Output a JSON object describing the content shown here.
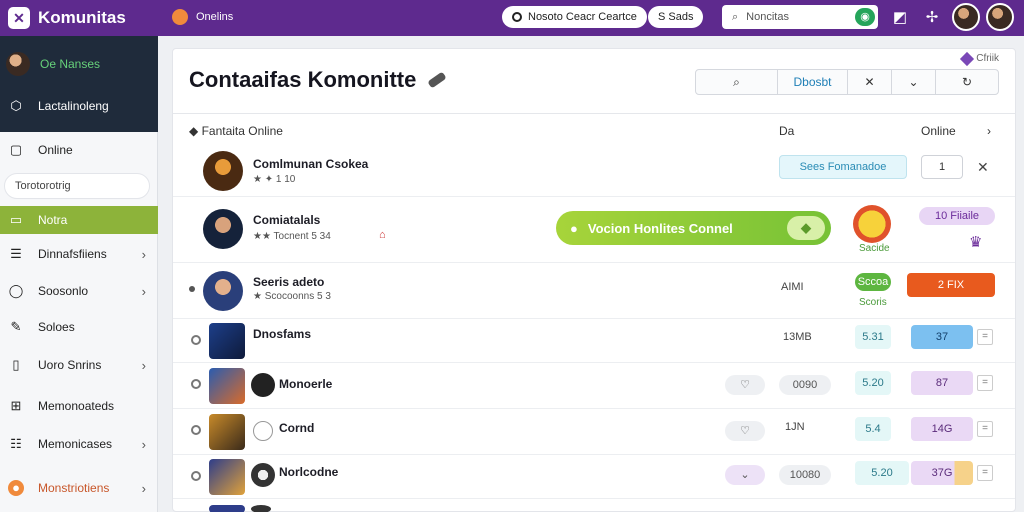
{
  "topbar": {
    "brand": "Komunitas",
    "status": "Onelins",
    "pill_left": "Nosoto Ceacr Ceartce",
    "pill_right": "S Sads",
    "search_placeholder": "Noncitas"
  },
  "sidebar": {
    "user": "Oe Nanses",
    "items": [
      {
        "label": "Lactalinoleng",
        "icon": "cube-icon"
      },
      {
        "label": "Online",
        "icon": "chat-icon"
      },
      {
        "label": "Torotorotrig",
        "icon": "search-icon"
      },
      {
        "label": "Notra",
        "icon": "note-icon"
      },
      {
        "label": "Dinnafsfiiens",
        "icon": "list-icon"
      },
      {
        "label": "Soosonlo",
        "icon": "circle-info-icon"
      },
      {
        "label": "Soloes",
        "icon": "wrench-icon"
      },
      {
        "label": "Uoro Snrins",
        "icon": "doc-icon"
      },
      {
        "label": "Memonoateds",
        "icon": "plus-box-icon"
      },
      {
        "label": "Memonicases",
        "icon": "book-icon"
      },
      {
        "label": "Monstriotiens",
        "icon": "orange-circle-icon"
      }
    ]
  },
  "main": {
    "title": "Contaaifas Komonitte",
    "top_link": "Cfriik",
    "toolbar": {
      "label": "Dbosbt"
    },
    "col_name": "Fantaita Online",
    "col_da": "Da",
    "col_online": "Online",
    "rows": [
      {
        "name": "Comlmunan Csokea",
        "sub": "1 10",
        "chip1": "Sees  Fomanadoe",
        "chip2": "1"
      },
      {
        "name": "Comiatalals",
        "sub": "Tocnent  5 34",
        "banner": "Vocion Honlites Connel",
        "tag1": "Sacide",
        "tag2": "10  Fiiaile"
      },
      {
        "name": "Seeris adeto",
        "sub": "Scocoonns  5 3",
        "value": "AIMI",
        "tag1": "Sccoa",
        "tag1b": "Scoris",
        "tag2": "2  FIX"
      },
      {
        "name": "Dnosfams",
        "value": "13MB",
        "v1": "5.31",
        "v2": "37"
      },
      {
        "name": "Monoerle",
        "value": "0090",
        "v1": "5.20",
        "v2": "87"
      },
      {
        "name": "Cornd",
        "value": "1JN",
        "v1": "5.4",
        "v2": "14G"
      },
      {
        "name": "Norlcodne",
        "value": "10080",
        "v1": "5.20",
        "v2": "37G"
      }
    ]
  },
  "colors": {
    "topbar": "#5e2a8e",
    "accent_green": "#8db33a",
    "sidebar_dark": "#1f2b3b"
  }
}
